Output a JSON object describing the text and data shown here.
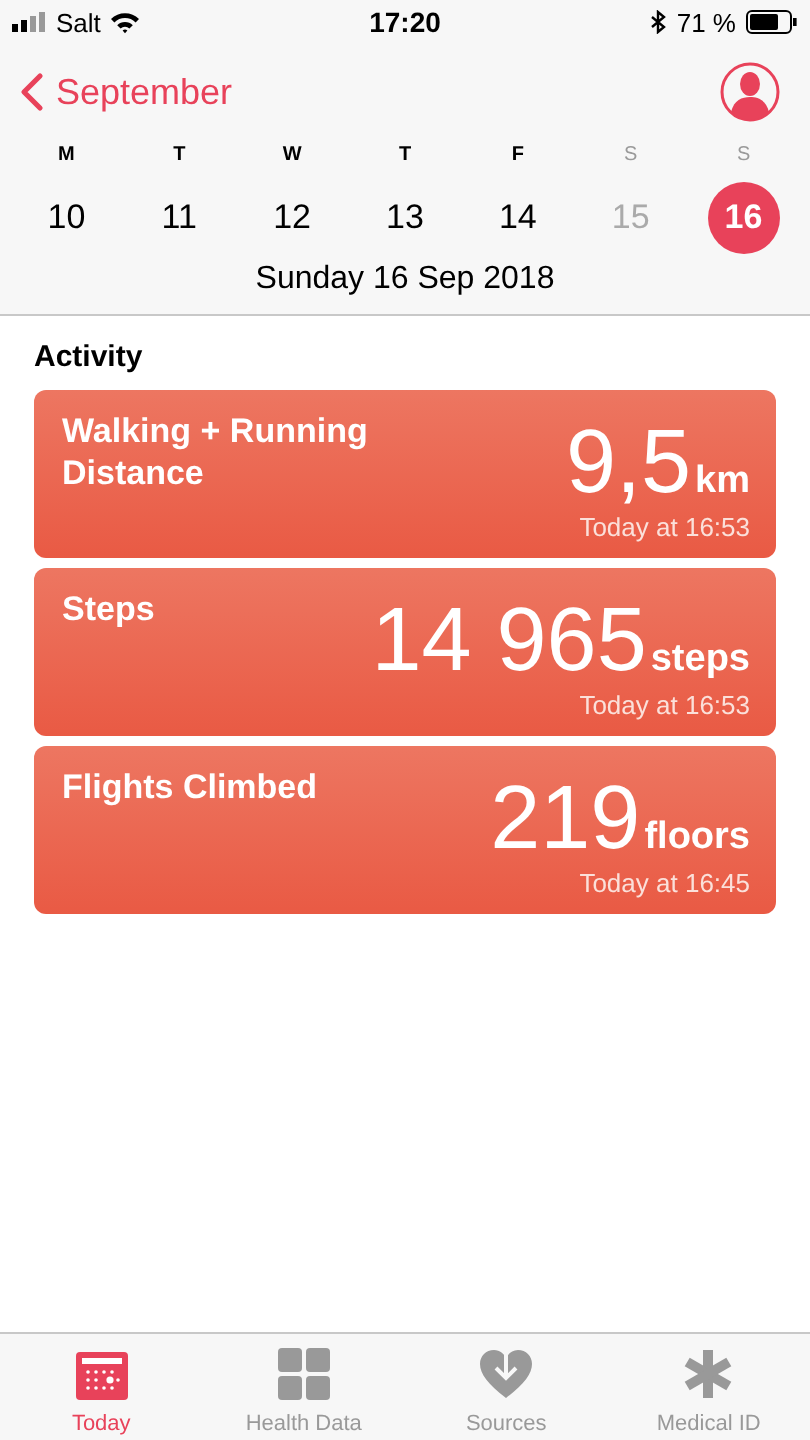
{
  "status_bar": {
    "carrier": "Salt",
    "time": "17:20",
    "battery": "71 %"
  },
  "nav": {
    "back": "September"
  },
  "week": [
    {
      "letter": "M",
      "day": "10",
      "dimmed": false,
      "selected": false
    },
    {
      "letter": "T",
      "day": "11",
      "dimmed": false,
      "selected": false
    },
    {
      "letter": "W",
      "day": "12",
      "dimmed": false,
      "selected": false
    },
    {
      "letter": "T",
      "day": "13",
      "dimmed": false,
      "selected": false
    },
    {
      "letter": "F",
      "day": "14",
      "dimmed": false,
      "selected": false
    },
    {
      "letter": "S",
      "day": "15",
      "dimmed": true,
      "selected": false
    },
    {
      "letter": "S",
      "day": "16",
      "dimmed": true,
      "selected": true
    }
  ],
  "date": "Sunday 16 Sep 2018",
  "section": "Activity",
  "cards": [
    {
      "title": "Walking + Running Distance",
      "value": "9,5",
      "unit": "km",
      "time": "Today at 16:53"
    },
    {
      "title": "Steps",
      "value": "14 965",
      "unit": "steps",
      "time": "Today at 16:53"
    },
    {
      "title": "Flights Climbed",
      "value": "219",
      "unit": "floors",
      "time": "Today at 16:45"
    }
  ],
  "tabs": [
    {
      "kind": "today",
      "label": "Today",
      "selected": true
    },
    {
      "kind": "grid",
      "label": "Health Data",
      "selected": false
    },
    {
      "kind": "sources",
      "label": "Sources",
      "selected": false
    },
    {
      "kind": "medical",
      "label": "Medical ID",
      "selected": false
    }
  ]
}
